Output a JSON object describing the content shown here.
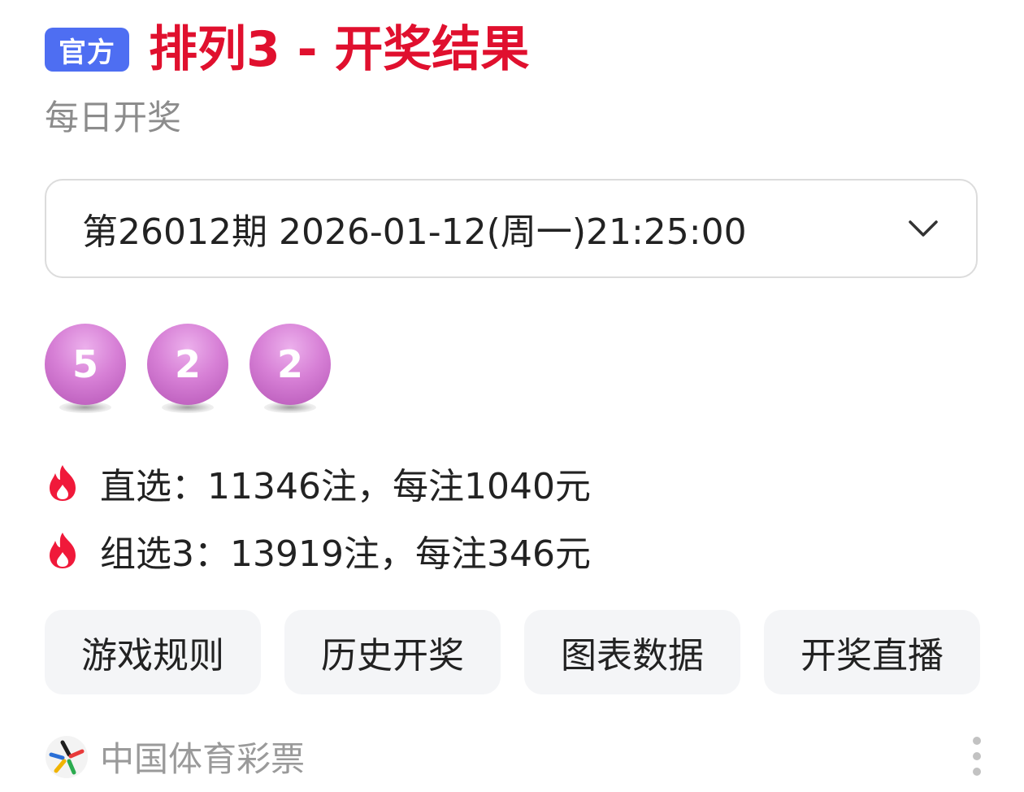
{
  "header": {
    "badge": "官方",
    "title": "排列3 - 开奖结果",
    "subtitle": "每日开奖"
  },
  "draw_select": {
    "value": "第26012期 2026-01-12(周一)21:25:00",
    "icon": "chevron-down-icon"
  },
  "balls": [
    "5",
    "2",
    "2"
  ],
  "prizes": [
    {
      "icon": "fire-icon",
      "text": "直选：11346注，每注1040元"
    },
    {
      "icon": "fire-icon",
      "text": "组选3：13919注，每注346元"
    }
  ],
  "actions": [
    "游戏规则",
    "历史开奖",
    "图表数据",
    "开奖直播"
  ],
  "footer": {
    "source": "中国体育彩票",
    "logo_icon": "china-sports-lottery-logo-icon",
    "more_icon": "more-vertical-icon"
  },
  "colors": {
    "accent_red": "#e0102e",
    "badge_blue": "#4e6ef2",
    "ball_purple": "#d780d6"
  }
}
